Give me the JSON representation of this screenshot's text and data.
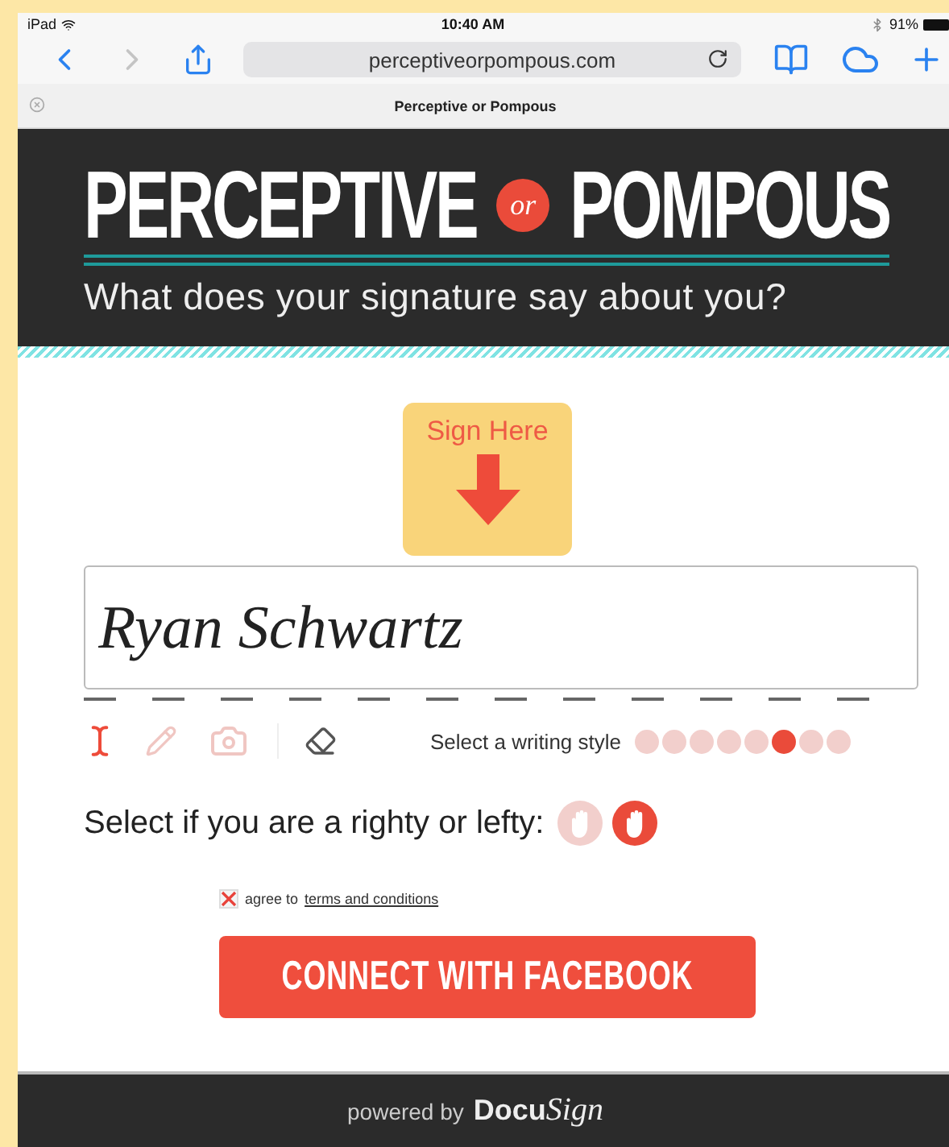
{
  "status_bar": {
    "device": "iPad",
    "time": "10:40 AM",
    "battery": "91%"
  },
  "browser": {
    "back_disabled": false,
    "forward_disabled": true,
    "url": "perceptiveorpompous.com",
    "tab_title": "Perceptive or Pompous"
  },
  "header": {
    "title_left": "PERCEPTIVE",
    "title_joiner": "or",
    "title_right": "POMPOUS",
    "tagline": "What does your signature say about you?"
  },
  "sign_here": {
    "label": "Sign Here"
  },
  "signature": {
    "value": "Ryan Schwartz"
  },
  "tools": [
    {
      "kind": "text",
      "selected": true
    },
    {
      "kind": "pencil",
      "selected": false
    },
    {
      "kind": "camera",
      "selected": false
    },
    {
      "kind": "eraser",
      "selected": false
    }
  ],
  "writing_style": {
    "label": "Select a writing style",
    "options": [
      {
        "selected": false
      },
      {
        "selected": false
      },
      {
        "selected": false
      },
      {
        "selected": false
      },
      {
        "selected": false
      },
      {
        "selected": true
      },
      {
        "selected": false
      },
      {
        "selected": false
      }
    ]
  },
  "handedness": {
    "label": "Select if you are a righty or lefty:",
    "options": [
      {
        "selected": false
      },
      {
        "selected": true
      }
    ]
  },
  "terms": {
    "checked": true,
    "text": "agree to",
    "link": "terms and conditions"
  },
  "connect_button": {
    "label": "CONNECT WITH FACEBOOK"
  },
  "footer": {
    "text": "powered by",
    "brand_left": "Docu",
    "brand_right": "Sign"
  }
}
